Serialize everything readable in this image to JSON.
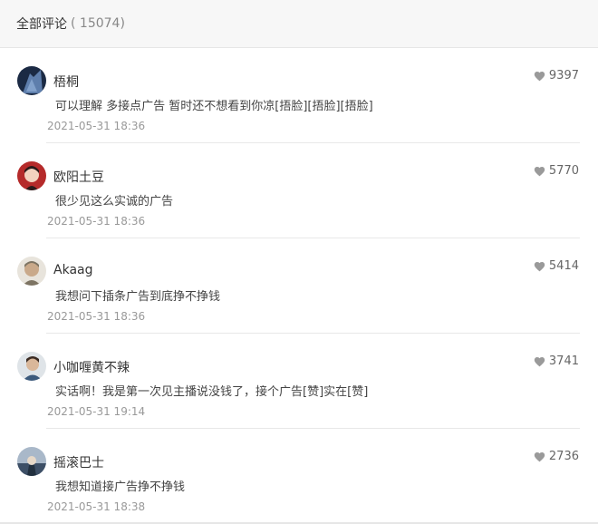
{
  "header": {
    "title": "全部评论",
    "count": "( 15074)"
  },
  "comments": [
    {
      "username": "梧桐",
      "text": "可以理解 多接点广告 暂时还不想看到你凉[捂脸][捂脸][捂脸]",
      "time": "2021-05-31 18:36",
      "likes": "9397",
      "avatar_colors": [
        "#1b2a44",
        "#6f93c7"
      ]
    },
    {
      "username": "欧阳土豆",
      "text": "很少见这么实诚的广告",
      "time": "2021-05-31 18:36",
      "likes": "5770",
      "avatar_colors": [
        "#b52a2a",
        "#f3d2bf"
      ]
    },
    {
      "username": "Akaag",
      "text": "我想问下插条广告到底挣不挣钱",
      "time": "2021-05-31 18:36",
      "likes": "5414",
      "avatar_colors": [
        "#e8e4dc",
        "#7d7463"
      ]
    },
    {
      "username": "小咖喱黄不辣",
      "text": "实话啊！我是第一次见主播说没钱了，接个广告[赞]实在[赞]",
      "time": "2021-05-31 19:14",
      "likes": "3741",
      "avatar_colors": [
        "#dfe4e8",
        "#3c5a7c"
      ]
    },
    {
      "username": "摇滚巴士",
      "text": "我想知道接广告挣不挣钱",
      "time": "2021-05-31 18:38",
      "likes": "2736",
      "avatar_colors": [
        "#a9b8c9",
        "#3d4f66"
      ]
    }
  ]
}
